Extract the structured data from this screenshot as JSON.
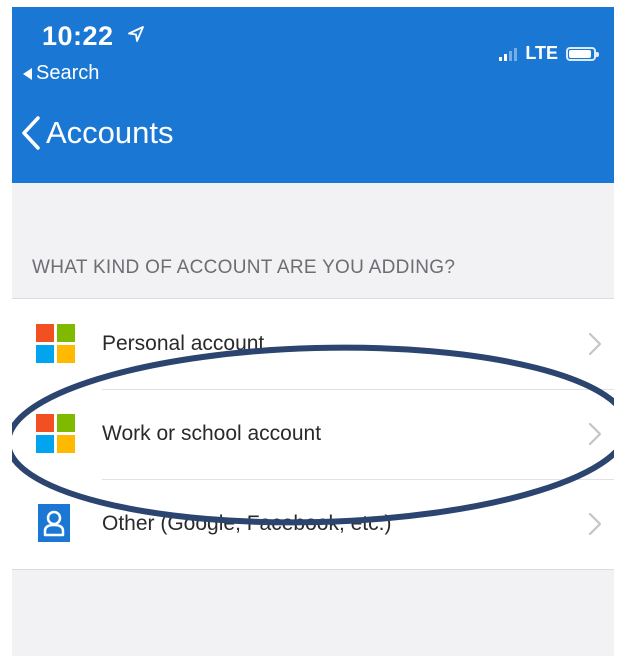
{
  "status_bar": {
    "time": "10:22",
    "back_app_label": "Search",
    "network": "LTE",
    "icons": [
      "location-arrow-icon",
      "signal-icon",
      "battery-icon"
    ]
  },
  "nav": {
    "title": "Accounts",
    "back_icon": "chevron-left-icon"
  },
  "section": {
    "header": "WHAT KIND OF ACCOUNT ARE YOU ADDING?"
  },
  "accounts": [
    {
      "label": "Personal account",
      "icon": "microsoft-logo-icon"
    },
    {
      "label": "Work or school account",
      "icon": "microsoft-logo-icon",
      "highlighted": true
    },
    {
      "label": "Other (Google, Facebook, etc.)",
      "icon": "person-icon"
    }
  ],
  "colors": {
    "accent": "#1a78d4",
    "background": "#f2f2f4",
    "annotation": "#2b4470",
    "ms_red": "#f25022",
    "ms_green": "#7fba00",
    "ms_blue": "#00a4ef",
    "ms_yellow": "#ffb900"
  }
}
